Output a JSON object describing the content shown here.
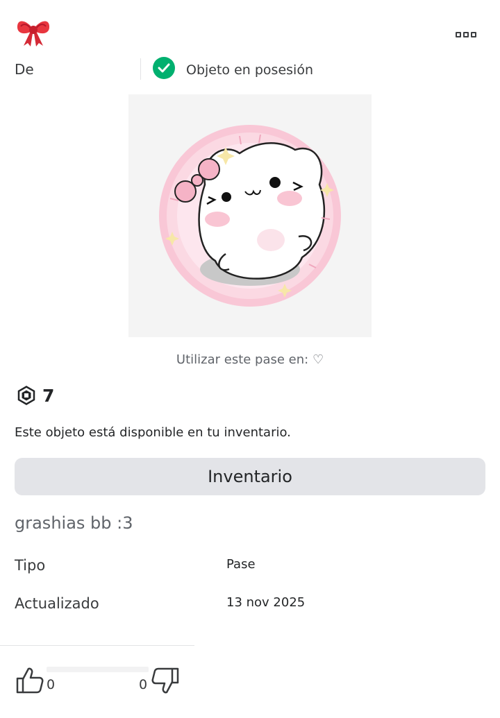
{
  "header": {
    "creator_emoji": "🎀",
    "more_icon": "more-options-icon"
  },
  "meta": {
    "from_label": "De",
    "owned_label": "Objeto en posesión",
    "owned_color": "#00b06f"
  },
  "item": {
    "use_in_label": "Utilizar este pase en: ♡",
    "price": "7",
    "availability_text": "Este objeto está disponible en tu inventario.",
    "inventory_button": "Inventario",
    "description": "grashias bb :3"
  },
  "details": [
    {
      "label": "Tipo",
      "value": "Pase"
    },
    {
      "label": "Actualizado",
      "value": "13 nov 2025"
    }
  ],
  "votes": {
    "up_count": "0",
    "down_count": "0"
  }
}
